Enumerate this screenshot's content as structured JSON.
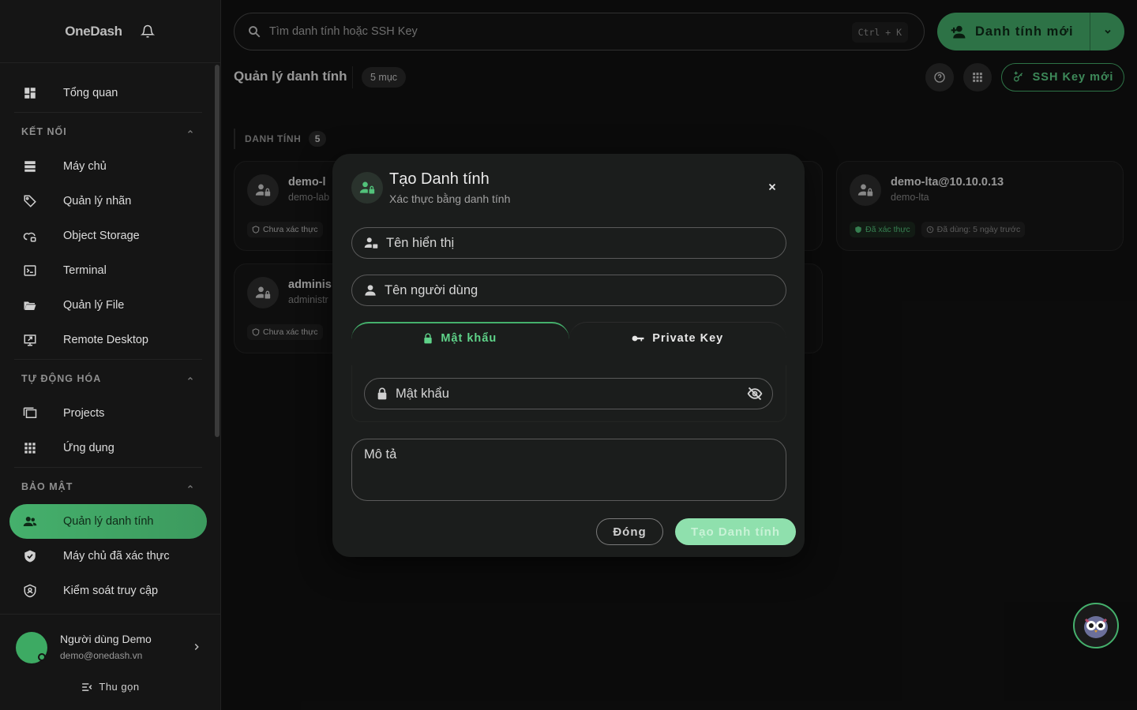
{
  "sidebar": {
    "logo": "OneDash",
    "overview": "Tổng quan",
    "sections": {
      "connect": "KẾT NỐI",
      "automation": "TỰ ĐỘNG HÓA",
      "security": "BẢO MẬT"
    },
    "connect_items": [
      "Máy chủ",
      "Quản lý nhãn",
      "Object Storage",
      "Terminal",
      "Quản lý File",
      "Remote Desktop"
    ],
    "automation_items": [
      "Projects",
      "Ứng dụng"
    ],
    "security_items": [
      "Quản lý danh tính",
      "Máy chủ đã xác thực",
      "Kiểm soát truy cập"
    ],
    "user_name": "Người dùng Demo",
    "user_email": "demo@onedash.vn",
    "collapse_label": "Thu gọn"
  },
  "topbar": {
    "search_placeholder": "Tìm danh tính hoặc SSH Key",
    "shortcut": "Ctrl + K",
    "new_identity": "Danh tính mới",
    "new_ssh_key": "SSH Key mới"
  },
  "page": {
    "title": "Quản lý danh tính",
    "count_badge": "5 mục",
    "group_label": "DANH TÍNH",
    "group_count": "5"
  },
  "cards": [
    {
      "name": "demo-l",
      "sub": "demo-lab",
      "status": "Chưa xác thực"
    },
    {
      "name": "adminis",
      "sub": "administr",
      "status": "Chưa xác thực"
    },
    {
      "name": "demo-lta@10.10.0.13",
      "sub": "demo-lta",
      "status": "Đã xác thực",
      "used": "Đã dùng: 5 ngày trước"
    }
  ],
  "modal": {
    "title": "Tạo Danh tính",
    "subtitle": "Xác thực bằng danh tính",
    "display_name_placeholder": "Tên hiển thị",
    "username_placeholder": "Tên người dùng",
    "tab_password": "Mật khẩu",
    "tab_private_key": "Private Key",
    "password_placeholder": "Mật khẩu",
    "description_placeholder": "Mô tả",
    "close_label": "Đóng",
    "create_label": "Tạo Danh tính"
  },
  "colors": {
    "accent": "#45b06c",
    "accent_text": "#5fd389",
    "background": "#121212"
  }
}
